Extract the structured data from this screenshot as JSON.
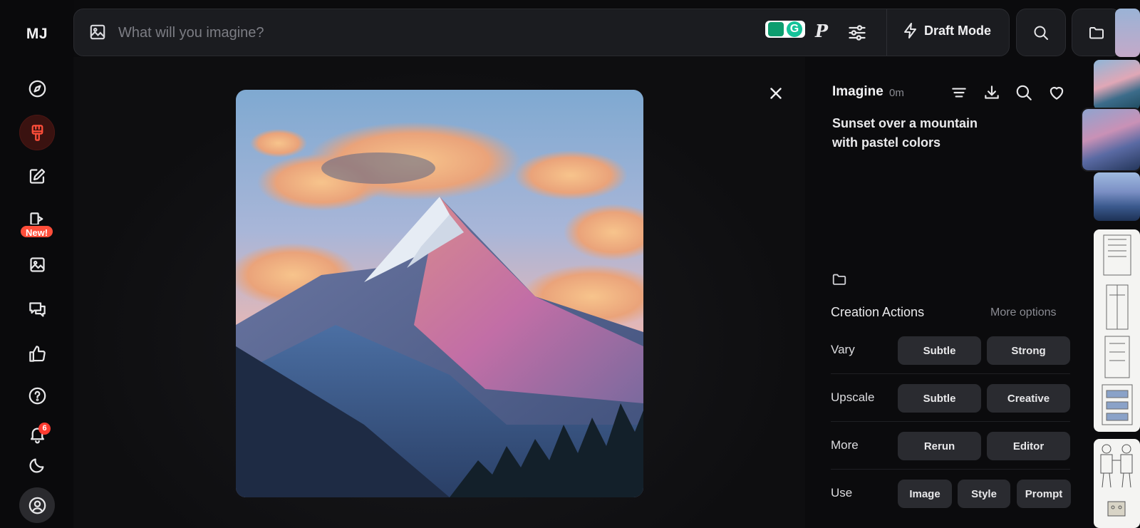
{
  "app": {
    "logo": "MJ"
  },
  "rail": {
    "items": [
      {
        "name": "explore",
        "icon": "compass-icon"
      },
      {
        "name": "create",
        "icon": "paintbrush-icon",
        "active": true
      },
      {
        "name": "edit",
        "icon": "pencil-square-icon"
      },
      {
        "name": "personalize",
        "icon": "new-feature-icon",
        "badge": "New!"
      },
      {
        "name": "organize",
        "icon": "image-icon"
      },
      {
        "name": "chat",
        "icon": "chat-bubbles-icon"
      },
      {
        "name": "rate",
        "icon": "thumbs-up-icon"
      },
      {
        "name": "help",
        "icon": "question-circle-icon"
      },
      {
        "name": "notifications",
        "icon": "bell-icon",
        "count": "6"
      },
      {
        "name": "theme",
        "icon": "moon-icon"
      },
      {
        "name": "profile",
        "icon": "user-circle-icon"
      }
    ]
  },
  "topbar": {
    "prompt_placeholder": "What will you imagine?",
    "personalize_label": "P",
    "draft_mode_label": "Draft Mode"
  },
  "details": {
    "title": "Imagine",
    "time": "0m",
    "prompt": "Sunset over a mountain with pastel colors",
    "actions_title": "Creation Actions",
    "more_options": "More options",
    "rows": [
      {
        "label": "Vary",
        "buttons": [
          "Subtle",
          "Strong"
        ]
      },
      {
        "label": "Upscale",
        "buttons": [
          "Subtle",
          "Creative"
        ]
      },
      {
        "label": "More",
        "buttons": [
          "Rerun",
          "Editor"
        ]
      },
      {
        "label": "Use",
        "buttons": [
          "Image",
          "Style",
          "Prompt"
        ]
      }
    ]
  },
  "colors": {
    "accent": "#ff4e3a",
    "panel_bg": "#1b1c20",
    "pill_bg": "#2a2b30"
  }
}
